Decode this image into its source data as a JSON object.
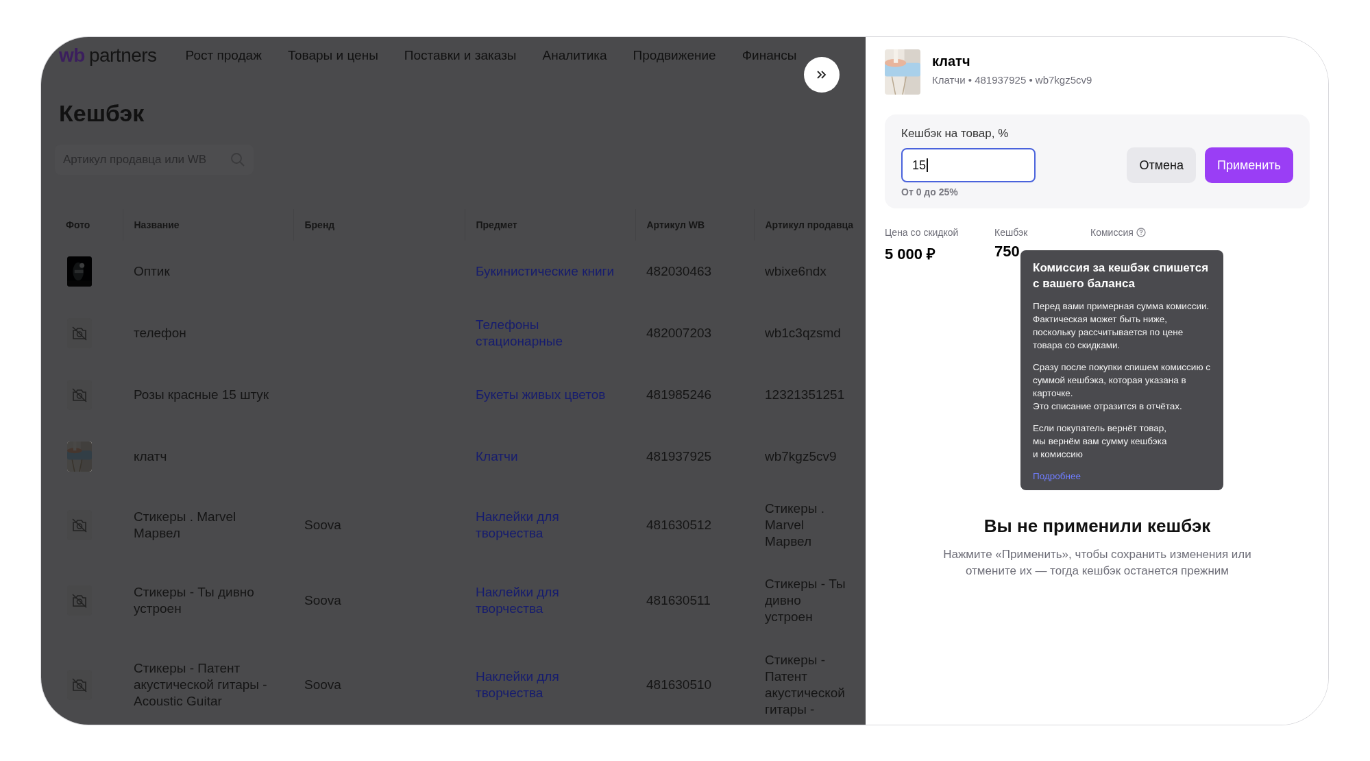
{
  "nav": {
    "logo": {
      "mark": "wb",
      "name": "partners"
    },
    "items": [
      "Рост продаж",
      "Товары и цены",
      "Поставки и заказы",
      "Аналитика",
      "Продвижение",
      "Финансы"
    ]
  },
  "page": {
    "title": "Кешбэк",
    "search": {
      "placeholder": "Артикул продавца или WB"
    }
  },
  "table": {
    "columns": [
      "Фото",
      "Название",
      "Бренд",
      "Предмет",
      "Артикул WB",
      "Артикул продавца"
    ],
    "rows": [
      {
        "has_photo": true,
        "name": "Оптик",
        "subject": "Букинистические книги",
        "article_wb": "482030463",
        "article_seller": "wbixe6ndx"
      },
      {
        "has_photo": false,
        "name": "телефон",
        "subject": "Телефоны стационарные",
        "article_wb": "482007203",
        "article_seller": "wb1c3qzsmd"
      },
      {
        "has_photo": false,
        "name": "Розы красные 15 штук",
        "subject": "Букеты живых цветов",
        "article_wb": "481985246",
        "article_seller": "12321351251"
      },
      {
        "has_photo": true,
        "name": "клатч",
        "subject": "Клатчи",
        "article_wb": "481937925",
        "article_seller": "wb7kgz5cv9"
      },
      {
        "has_photo": false,
        "name": "Стикеры . Marvel Марвел",
        "brand": "Soova",
        "subject": "Наклейки для творчества",
        "article_wb": "481630512",
        "article_seller": "Стикеры . Marvel Марвел"
      },
      {
        "has_photo": false,
        "name": "Стикеры - Ты дивно устроен",
        "brand": "Soova",
        "subject": "Наклейки для творчества",
        "article_wb": "481630511",
        "article_seller": "Стикеры - Ты дивно устроен"
      },
      {
        "has_photo": false,
        "name": "Стикеры - Патент акустической гитары - Acoustic Guitar",
        "brand": "Soova",
        "subject": "Наклейки для творчества",
        "article_wb": "481630510",
        "article_seller": "Стикеры - Патент акустической гитары -"
      }
    ]
  },
  "drawer": {
    "product": {
      "has_photo": true,
      "name": "клатч",
      "meta": "Клатчи • 481937925 • wb7kgz5cv9"
    },
    "cashback": {
      "label": "Кешбэк на товар, %",
      "value": "15",
      "focused": true,
      "hint": "От 0 до 25%",
      "buttons": [
        {
          "label": "Отмена",
          "kind": "secondary"
        },
        {
          "label": "Применить",
          "kind": "primary"
        }
      ]
    },
    "stats": [
      {
        "label": "Цена со скидкой",
        "value": "5 000 ₽",
        "info": false
      },
      {
        "label": "Кешбэк",
        "value": "750",
        "info": false
      },
      {
        "label": "Комиссия",
        "info": true
      }
    ],
    "tooltip": {
      "title": "Комиссия за кешбэк спишется с вашего баланса",
      "paragraphs": [
        "Перед вами примерная сумма комиссии. Фактическая может быть ниже, поскольку рассчитывается по цене товара со скидками.",
        "Сразу после покупки спишем комиссию с суммой кешбэка, которая указана в карточке.\nЭто списание отразится в отчётах.",
        "Если покупатель вернёт товар,\nмы вернём вам сумму кешбэка\nи комиссию"
      ],
      "link": "Подробнее"
    },
    "empty_state": {
      "title": "Вы не применили кешбэк",
      "text": "Нажмите «Применить», чтобы сохранить изменения или отмените их — тогда кешбэк останется прежним"
    }
  }
}
